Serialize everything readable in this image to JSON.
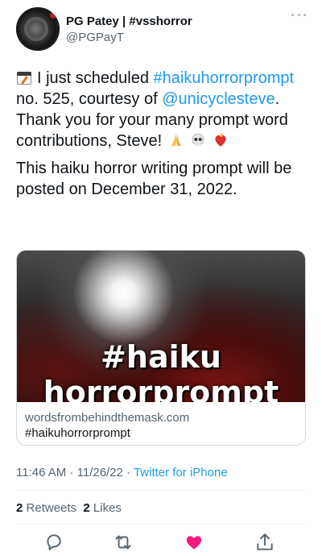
{
  "author": {
    "display_name": "PG Patey | #vsshorror",
    "handle": "@PGPayT"
  },
  "tweet": {
    "icon_name": "calendar-spiral-icon",
    "p1_a": "I just scheduled",
    "p1_hashtag": "#haikuhorrorprompt",
    "p1_b": " no. 525, courtesy of ",
    "p1_mention": "@unicyclesteve",
    "p1_c": ". Thank you for your many prompt word contributions, Steve!",
    "p1_emojis": [
      "folded-hands-emoji",
      "skull-emoji",
      "heart-on-fire-emoji"
    ],
    "p2": "This haiku horror writing prompt will be posted on December 31, 2022."
  },
  "card": {
    "image_text_line1": "#haiku",
    "image_text_line2": "horrorprompt",
    "domain": "wordsfrombehindthemask.com",
    "title": "#haikuhorrorprompt"
  },
  "meta": {
    "time": "11:46 AM",
    "sep1": " · ",
    "date": "11/26/22",
    "sep2": " · ",
    "source": "Twitter for iPhone"
  },
  "stats": {
    "retweets_count": "2",
    "retweets_label": "Retweets",
    "likes_count": "2",
    "likes_label": "Likes"
  },
  "colors": {
    "link": "#1d9bf0",
    "secondary_text": "#536471",
    "like_pink": "#f91880"
  },
  "actions": [
    "reply-icon",
    "retweet-icon",
    "like-heart-icon",
    "share-icon"
  ]
}
